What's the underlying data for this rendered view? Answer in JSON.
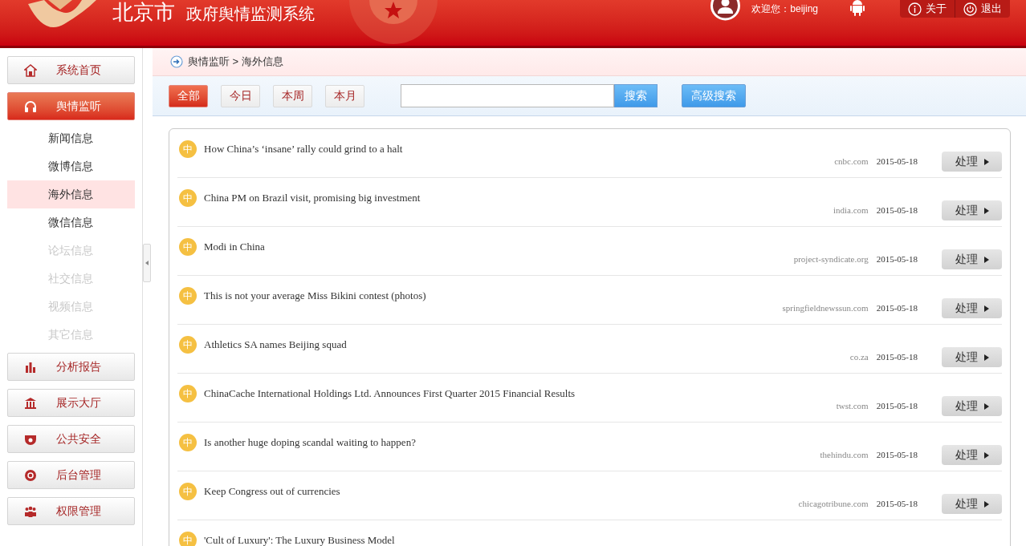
{
  "header": {
    "city": "北京市",
    "system_name": "政府舆情监测系统",
    "welcome": "欢迎您：beijing",
    "buttons": [
      {
        "kind": "about",
        "label": "关于"
      },
      {
        "kind": "logout",
        "label": "退出"
      }
    ]
  },
  "sidebar": {
    "items": [
      {
        "kind": "main",
        "label": "系统首页",
        "selected": false
      },
      {
        "kind": "main",
        "label": "舆情监听",
        "selected": true
      },
      {
        "kind": "sub",
        "label": "新闻信息",
        "selected": false,
        "disabled": false
      },
      {
        "kind": "sub",
        "label": "微博信息",
        "selected": false,
        "disabled": false
      },
      {
        "kind": "sub",
        "label": "海外信息",
        "selected": true,
        "disabled": false
      },
      {
        "kind": "sub",
        "label": "微信信息",
        "selected": false,
        "disabled": false
      },
      {
        "kind": "sub",
        "label": "论坛信息",
        "selected": false,
        "disabled": true
      },
      {
        "kind": "sub",
        "label": "社交信息",
        "selected": false,
        "disabled": true
      },
      {
        "kind": "sub",
        "label": "视频信息",
        "selected": false,
        "disabled": true
      },
      {
        "kind": "sub",
        "label": "其它信息",
        "selected": false,
        "disabled": true
      },
      {
        "kind": "main",
        "label": "分析报告",
        "selected": false
      },
      {
        "kind": "main",
        "label": "展示大厅",
        "selected": false
      },
      {
        "kind": "main",
        "label": "公共安全",
        "selected": false
      },
      {
        "kind": "main",
        "label": "后台管理",
        "selected": false
      },
      {
        "kind": "main",
        "label": "权限管理",
        "selected": false
      }
    ]
  },
  "breadcrumb": "舆情监听 > 海外信息",
  "filters": [
    {
      "label": "全部",
      "selected": true
    },
    {
      "label": "今日",
      "selected": false
    },
    {
      "label": "本周",
      "selected": false
    },
    {
      "label": "本月",
      "selected": false
    }
  ],
  "search": {
    "button": "搜索",
    "advanced": "高级搜索"
  },
  "articles": [
    {
      "badge": "中",
      "title": "How China’s ‘insane’ rally could grind to a halt",
      "source": "cnbc.com",
      "date": "2015-05-18",
      "action": "处理"
    },
    {
      "badge": "中",
      "title": "China PM on Brazil visit, promising big investment",
      "source": "india.com",
      "date": "2015-05-18",
      "action": "处理"
    },
    {
      "badge": "中",
      "title": "Modi in China",
      "source": "project-syndicate.org",
      "date": "2015-05-18",
      "action": "处理"
    },
    {
      "badge": "中",
      "title": "This is not your average Miss Bikini contest (photos)",
      "source": "springfieldnewssun.com",
      "date": "2015-05-18",
      "action": "处理"
    },
    {
      "badge": "中",
      "title": "Athletics SA names Beijing squad",
      "source": "co.za",
      "date": "2015-05-18",
      "action": "处理"
    },
    {
      "badge": "中",
      "title": "ChinaCache International Holdings Ltd. Announces First Quarter 2015 Financial Results",
      "source": "twst.com",
      "date": "2015-05-18",
      "action": "处理"
    },
    {
      "badge": "中",
      "title": "Is another huge doping scandal waiting to happen?",
      "source": "thehindu.com",
      "date": "2015-05-18",
      "action": "处理"
    },
    {
      "badge": "中",
      "title": "Keep Congress out of currencies",
      "source": "chicagotribune.com",
      "date": "2015-05-18",
      "action": "处理"
    },
    {
      "badge": "中",
      "title": "'Cult of Luxury': The Luxury Business Model"
    }
  ]
}
